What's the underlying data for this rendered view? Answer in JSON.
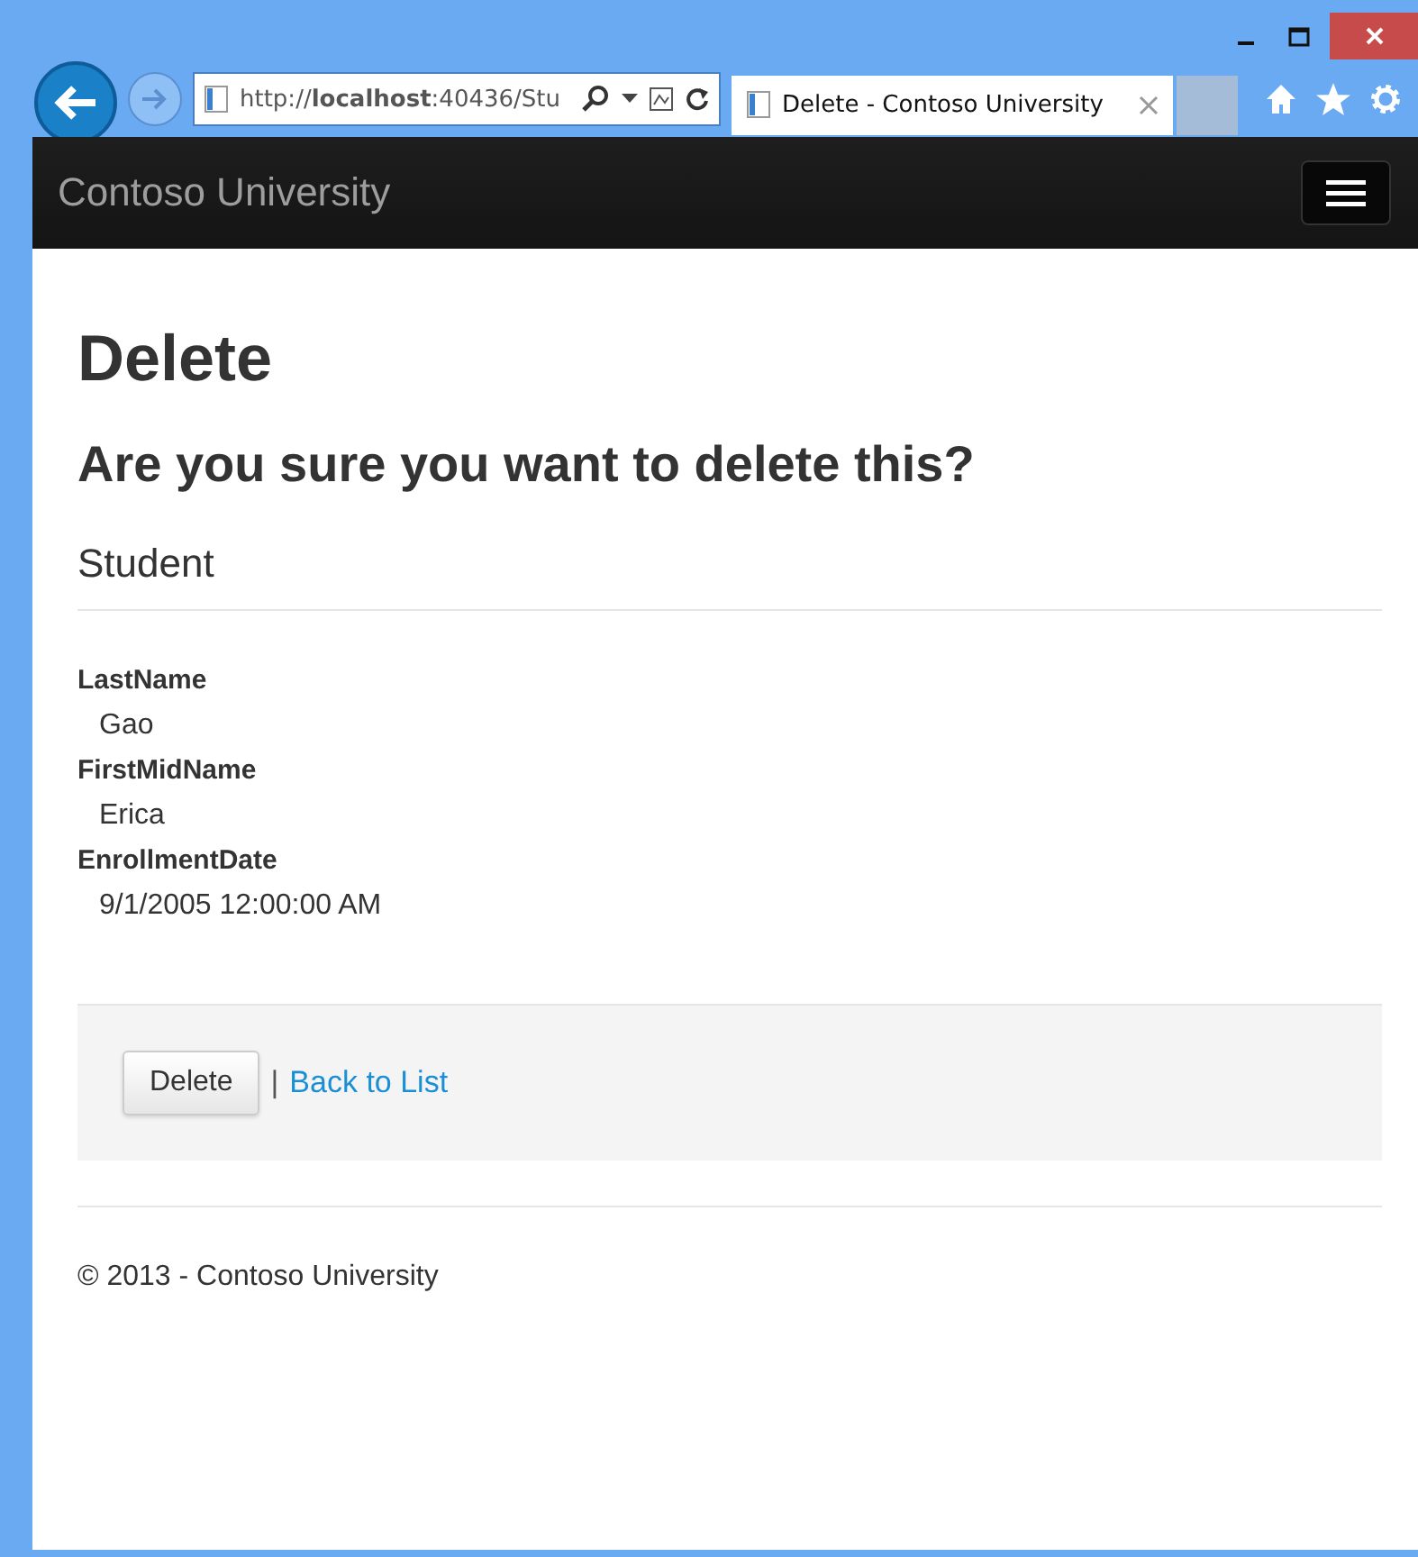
{
  "browser": {
    "address": "http://**localhost**:40436/Stu",
    "tabs": [
      {
        "title": "Delete - Contoso University",
        "selected": true
      }
    ]
  },
  "navbar": {
    "brand": "Contoso University"
  },
  "page": {
    "title": "Delete",
    "question": "Are you sure you want to delete this?",
    "section": "Student",
    "fields": [
      {
        "label": "LastName",
        "value": "Gao"
      },
      {
        "label": "FirstMidName",
        "value": "Erica"
      },
      {
        "label": "EnrollmentDate",
        "value": "9/1/2005 12:00:00 AM"
      }
    ],
    "actions": {
      "button": "Delete",
      "separator": "|",
      "link": "Back to List"
    }
  },
  "footer": {
    "text": "© 2013 - Contoso University"
  }
}
